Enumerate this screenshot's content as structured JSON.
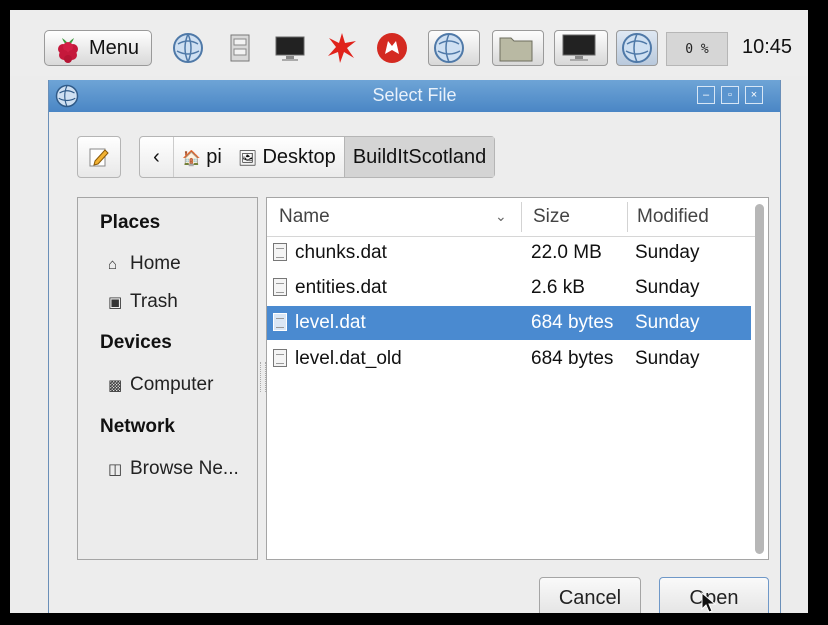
{
  "taskbar": {
    "menu_label": "Menu",
    "cpu_usage": "0 %",
    "clock": "10:45",
    "launchers": [
      "raspberry-icon",
      "browser-icon",
      "file-manager-icon",
      "terminal-icon",
      "mathematica-icon",
      "wolfram-icon"
    ],
    "windows": [
      "browser-window-icon",
      "file-manager-window-icon",
      "terminal-window-icon",
      "browser-window-icon"
    ]
  },
  "dialog": {
    "title": "Select File",
    "path": {
      "back_glyph": "‹",
      "segments": [
        "pi",
        "Desktop",
        "BuildItScotland"
      ]
    },
    "places": {
      "places_heading": "Places",
      "home": "Home",
      "trash": "Trash",
      "devices_heading": "Devices",
      "computer": "Computer",
      "network_heading": "Network",
      "browse_network": "Browse Ne..."
    },
    "columns": {
      "name": "Name",
      "size": "Size",
      "modified": "Modified"
    },
    "files": [
      {
        "name": "chunks.dat",
        "size": "22.0 MB",
        "modified": "Sunday",
        "selected": false
      },
      {
        "name": "entities.dat",
        "size": "2.6 kB",
        "modified": "Sunday",
        "selected": false
      },
      {
        "name": "level.dat",
        "size": "684 bytes",
        "modified": "Sunday",
        "selected": true
      },
      {
        "name": "level.dat_old",
        "size": "684 bytes",
        "modified": "Sunday",
        "selected": false
      }
    ],
    "buttons": {
      "cancel": "Cancel",
      "open": "Open"
    }
  },
  "colors": {
    "titlebar": "#4a86c5",
    "selection": "#4a8ad0"
  }
}
